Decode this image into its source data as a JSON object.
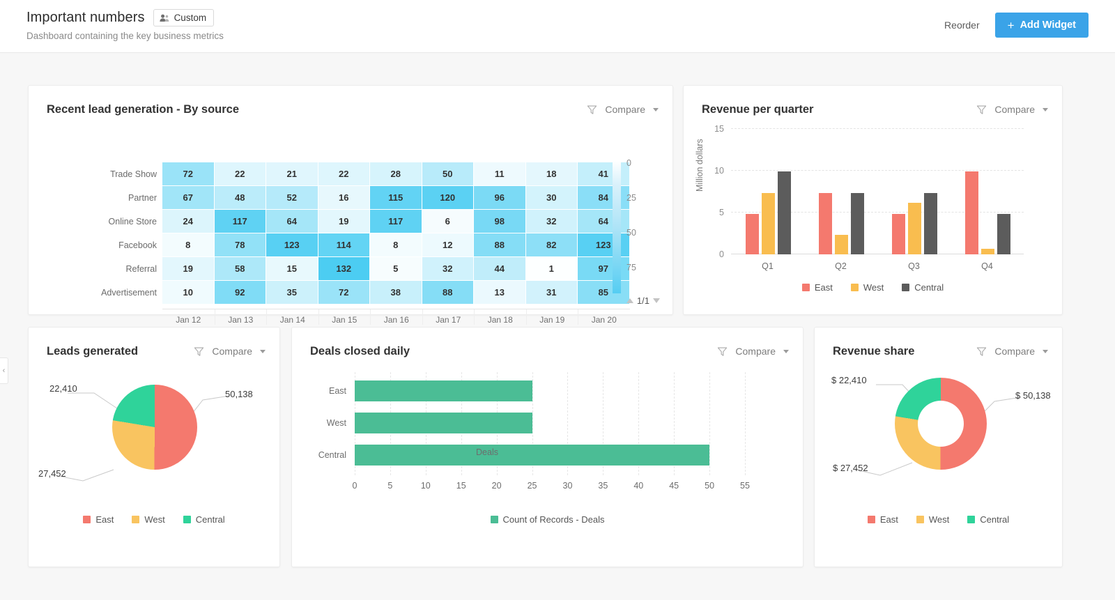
{
  "header": {
    "title": "Important numbers",
    "badge_label": "Custom",
    "badge_icon": "users-icon",
    "subtitle": "Dashboard containing the key business metrics",
    "reorder_label": "Reorder",
    "add_widget_label": "Add Widget",
    "add_icon": "plus-icon",
    "accent_color": "#3aa3e8"
  },
  "left_rail": {
    "collapse_icon": "chevron-left-icon"
  },
  "common": {
    "compare_label": "Compare",
    "filter_icon": "filter-funnel-icon",
    "caret_icon": "chevron-down-icon"
  },
  "widgets": {
    "heatmap": {
      "title": "Recent lead generation - By source",
      "pager": "1/1",
      "scale_ticks": [
        "0",
        "25",
        "50",
        "75"
      ]
    },
    "quarter": {
      "title": "Revenue per quarter"
    },
    "pie": {
      "title": "Leads generated"
    },
    "deals": {
      "title": "Deals closed daily"
    },
    "donut": {
      "title": "Revenue share"
    }
  },
  "chart_data": [
    {
      "type": "heatmap",
      "title": "Recent lead generation - By source",
      "xlabel": "",
      "ylabel": "",
      "columns": [
        "Jan 12",
        "Jan 13",
        "Jan 14",
        "Jan 15",
        "Jan 16",
        "Jan 17",
        "Jan 18",
        "Jan 19",
        "Jan 20"
      ],
      "rows": [
        "Trade Show",
        "Partner",
        "Online Store",
        "Facebook",
        "Referral",
        "Advertisement"
      ],
      "values": [
        [
          72,
          22,
          21,
          22,
          28,
          50,
          11,
          18,
          41
        ],
        [
          67,
          48,
          52,
          16,
          115,
          120,
          96,
          30,
          84
        ],
        [
          24,
          117,
          64,
          19,
          117,
          6,
          98,
          32,
          64
        ],
        [
          8,
          78,
          123,
          114,
          8,
          12,
          88,
          82,
          123
        ],
        [
          19,
          58,
          15,
          132,
          5,
          32,
          44,
          1,
          97
        ],
        [
          10,
          92,
          35,
          72,
          38,
          88,
          13,
          31,
          85
        ]
      ],
      "colorscale_ticks": [
        0,
        25,
        50,
        75
      ],
      "colorscale_low": "#ffffff",
      "colorscale_high": "#4ccdf2",
      "grid": false,
      "legend_position": "right"
    },
    {
      "type": "bar",
      "title": "Revenue per quarter",
      "categories": [
        "Q1",
        "Q2",
        "Q3",
        "Q4"
      ],
      "series": [
        {
          "name": "East",
          "color": "#f4796e",
          "values": [
            4.8,
            7.3,
            4.8,
            9.9
          ]
        },
        {
          "name": "West",
          "color": "#f9bd4f",
          "values": [
            7.3,
            2.3,
            6.2,
            0.7
          ]
        },
        {
          "name": "Central",
          "color": "#5c5c5c",
          "values": [
            9.9,
            7.3,
            7.3,
            4.8
          ]
        }
      ],
      "xlabel": "",
      "ylabel": "Million dollars",
      "ylim": [
        0,
        15
      ],
      "yticks": [
        0,
        5,
        10,
        15
      ],
      "grid": true,
      "legend_position": "bottom"
    },
    {
      "type": "pie",
      "title": "Leads generated",
      "labels": [
        "East",
        "West",
        "Central"
      ],
      "values": [
        50138,
        27452,
        22410
      ],
      "value_labels": [
        "50,138",
        "27,452",
        "22,410"
      ],
      "colors": [
        "#f4796e",
        "#f9c460",
        "#2fd39a"
      ],
      "legend_position": "bottom"
    },
    {
      "type": "bar",
      "orientation": "horizontal",
      "title": "Deals closed daily",
      "categories": [
        "East",
        "West",
        "Central"
      ],
      "values": [
        25,
        25,
        50
      ],
      "series_name": "Count of Records - Deals",
      "color": "#4bbd95",
      "xlabel": "Deals",
      "ylabel": "",
      "xlim": [
        0,
        55
      ],
      "xticks": [
        0,
        5,
        10,
        15,
        20,
        25,
        30,
        35,
        40,
        45,
        50,
        55
      ],
      "grid": true,
      "legend_position": "bottom"
    },
    {
      "type": "pie",
      "variant": "donut",
      "title": "Revenue share",
      "labels": [
        "East",
        "West",
        "Central"
      ],
      "values": [
        50138,
        27452,
        22410
      ],
      "value_labels": [
        "$ 50,138",
        "$ 27,452",
        "$ 22,410"
      ],
      "colors": [
        "#f4796e",
        "#f9c460",
        "#2fd39a"
      ],
      "legend_position": "bottom"
    }
  ]
}
